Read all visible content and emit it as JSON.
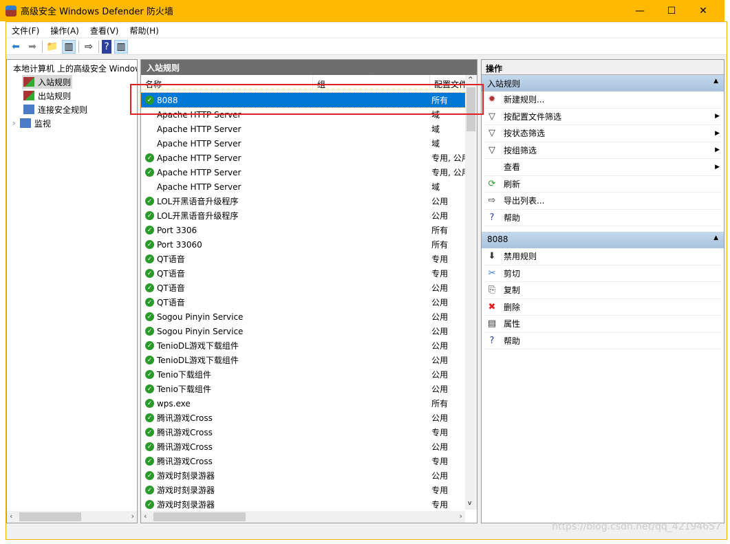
{
  "window": {
    "title": "高级安全 Windows Defender 防火墙",
    "minimize": "—",
    "maximize": "☐",
    "close": "✕"
  },
  "menu": [
    "文件(F)",
    "操作(A)",
    "查看(V)",
    "帮助(H)"
  ],
  "tree": {
    "root": "本地计算机 上的高级安全 Windows Defender 防火墙",
    "items": [
      "入站规则",
      "出站规则",
      "连接安全规则",
      "监视"
    ]
  },
  "middle": {
    "title": "入站规则",
    "columns": [
      "名称",
      "组",
      "配置文件"
    ],
    "rows": [
      {
        "name": "8088",
        "enabled": true,
        "profile": "所有",
        "selected": true
      },
      {
        "name": "Apache HTTP Server",
        "enabled": false,
        "profile": "域"
      },
      {
        "name": "Apache HTTP Server",
        "enabled": false,
        "profile": "域"
      },
      {
        "name": "Apache HTTP Server",
        "enabled": false,
        "profile": "域"
      },
      {
        "name": "Apache HTTP Server",
        "enabled": true,
        "profile": "专用, 公用"
      },
      {
        "name": "Apache HTTP Server",
        "enabled": true,
        "profile": "专用, 公用"
      },
      {
        "name": "Apache HTTP Server",
        "enabled": false,
        "profile": "域"
      },
      {
        "name": "LOL开黑语音升级程序",
        "enabled": true,
        "profile": "公用"
      },
      {
        "name": "LOL开黑语音升级程序",
        "enabled": true,
        "profile": "公用"
      },
      {
        "name": "Port 3306",
        "enabled": true,
        "profile": "所有"
      },
      {
        "name": "Port 33060",
        "enabled": true,
        "profile": "所有"
      },
      {
        "name": "QT语音",
        "enabled": true,
        "profile": "专用"
      },
      {
        "name": "QT语音",
        "enabled": true,
        "profile": "专用"
      },
      {
        "name": "QT语音",
        "enabled": true,
        "profile": "公用"
      },
      {
        "name": "QT语音",
        "enabled": true,
        "profile": "公用"
      },
      {
        "name": "Sogou Pinyin Service",
        "enabled": true,
        "profile": "公用"
      },
      {
        "name": "Sogou Pinyin Service",
        "enabled": true,
        "profile": "公用"
      },
      {
        "name": "TenioDL游戏下载组件",
        "enabled": true,
        "profile": "公用"
      },
      {
        "name": "TenioDL游戏下载组件",
        "enabled": true,
        "profile": "公用"
      },
      {
        "name": "Tenio下载组件",
        "enabled": true,
        "profile": "公用"
      },
      {
        "name": "Tenio下载组件",
        "enabled": true,
        "profile": "公用"
      },
      {
        "name": "wps.exe",
        "enabled": true,
        "profile": "所有"
      },
      {
        "name": "腾讯游戏Cross",
        "enabled": true,
        "profile": "公用"
      },
      {
        "name": "腾讯游戏Cross",
        "enabled": true,
        "profile": "专用"
      },
      {
        "name": "腾讯游戏Cross",
        "enabled": true,
        "profile": "公用"
      },
      {
        "name": "腾讯游戏Cross",
        "enabled": true,
        "profile": "专用"
      },
      {
        "name": "游戏时刻录游器",
        "enabled": true,
        "profile": "公用"
      },
      {
        "name": "游戏时刻录游器",
        "enabled": true,
        "profile": "专用"
      },
      {
        "name": "游戏时刻录游器",
        "enabled": true,
        "profile": "专用"
      }
    ]
  },
  "actions": {
    "title": "操作",
    "sections": [
      {
        "title": "入站规则",
        "items": [
          {
            "label": "新建规则...",
            "icon": "new-rule-icon",
            "glyph": "✹"
          },
          {
            "label": "按配置文件筛选",
            "icon": "filter-icon",
            "glyph": "▽",
            "submenu": true
          },
          {
            "label": "按状态筛选",
            "icon": "filter-icon",
            "glyph": "▽",
            "submenu": true
          },
          {
            "label": "按组筛选",
            "icon": "filter-icon",
            "glyph": "▽",
            "submenu": true
          },
          {
            "label": "查看",
            "icon": "",
            "glyph": "",
            "submenu": true
          },
          {
            "label": "刷新",
            "icon": "refresh-icon",
            "glyph": "⟳"
          },
          {
            "label": "导出列表...",
            "icon": "export-icon",
            "glyph": "⇨"
          },
          {
            "label": "帮助",
            "icon": "help-icon",
            "glyph": "?"
          }
        ]
      },
      {
        "title": "8088",
        "items": [
          {
            "label": "禁用规则",
            "icon": "disable-icon",
            "glyph": "⬇"
          },
          {
            "label": "剪切",
            "icon": "cut-icon",
            "glyph": "✂"
          },
          {
            "label": "复制",
            "icon": "copy-icon",
            "glyph": "⎘"
          },
          {
            "label": "删除",
            "icon": "delete-icon",
            "glyph": "✖"
          },
          {
            "label": "属性",
            "icon": "properties-icon",
            "glyph": "▤"
          },
          {
            "label": "帮助",
            "icon": "help-icon",
            "glyph": "?"
          }
        ]
      }
    ]
  },
  "watermark": "https://blog.csdn.net/qq_42194657",
  "colors": {
    "titlebar": "#ffb900",
    "selection": "#0078d7",
    "highlight_box": "#e02020"
  }
}
